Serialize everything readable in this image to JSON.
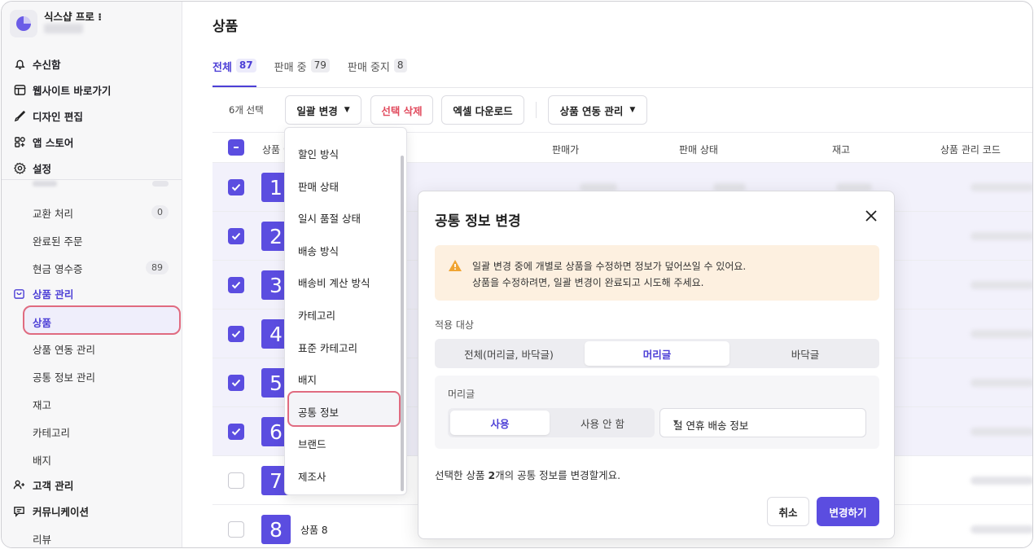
{
  "sidebar": {
    "store_name": "식스샵 프로 ⁝",
    "nav_top": [
      {
        "label": "수신함",
        "icon": "bell-icon"
      },
      {
        "label": "웹사이트 바로가기",
        "icon": "website-icon"
      },
      {
        "label": "디자인 편집",
        "icon": "brush-icon"
      },
      {
        "label": "앱 스토어",
        "icon": "apps-icon"
      },
      {
        "label": "설정",
        "icon": "gear-icon"
      }
    ],
    "order_items": [
      {
        "label": "교환 처리",
        "badge": "0"
      },
      {
        "label": "완료된 주문",
        "badge": ""
      },
      {
        "label": "현금 영수증",
        "badge": "89"
      }
    ],
    "product_group": "상품 관리",
    "product_items": [
      "상품",
      "상품 연동 관리",
      "공통 정보 관리",
      "재고",
      "카테고리",
      "배지"
    ],
    "customer_group": "고객 관리",
    "community_group": "커뮤니케이션",
    "review": "리뷰"
  },
  "main": {
    "title": "상품",
    "tabs": [
      {
        "label": "전체",
        "count": "87"
      },
      {
        "label": "판매 중",
        "count": "79"
      },
      {
        "label": "판매 중지",
        "count": "8"
      }
    ],
    "toolbar": {
      "selected": "6개 선택",
      "bulk_edit": "일괄 변경",
      "delete": "선택 삭제",
      "excel": "엑셀 다운로드",
      "link_manage": "상품 연동 관리"
    },
    "columns": [
      "상품 이",
      "판매가",
      "판매 상태",
      "재고",
      "상품 관리 코드"
    ],
    "rows": [
      {
        "num": "1",
        "name": "",
        "checked": true
      },
      {
        "num": "2",
        "name": "",
        "checked": true
      },
      {
        "num": "3",
        "name": "",
        "checked": true
      },
      {
        "num": "4",
        "name": "",
        "checked": true
      },
      {
        "num": "5",
        "name": "",
        "checked": true
      },
      {
        "num": "6",
        "name": "",
        "checked": true
      },
      {
        "num": "7",
        "name": "",
        "checked": false
      },
      {
        "num": "8",
        "name": "상품 8",
        "checked": false
      }
    ]
  },
  "dropdown": [
    "할인 방식",
    "판매 상태",
    "일시 품절 상태",
    "배송 방식",
    "배송비 계산 방식",
    "카테고리",
    "표준 카테고리",
    "배지",
    "공통 정보",
    "브랜드",
    "제조사"
  ],
  "modal": {
    "title": "공통 정보 변경",
    "warning_line1": "일괄 변경 중에 개별로 상품을 수정하면 정보가 덮어쓰일 수 있어요.",
    "warning_line2": "상품을 수정하려면, 일괄 변경이 완료되고 시도해 주세요.",
    "target_label": "적용 대상",
    "target_options": [
      "전체(머리글, 바닥글)",
      "머리글",
      "바닥글"
    ],
    "target_selected": "머리글",
    "header_label": "머리글",
    "use_options": [
      "사용",
      "사용 안 함"
    ],
    "use_selected": "사용",
    "select_value": "설 연휴 배송 정보",
    "summary_pre": "선택한 상품 ",
    "summary_bold": "2",
    "summary_post": "개의 공통 정보를 변경할게요.",
    "cancel": "취소",
    "confirm": "변경하기"
  },
  "colors": {
    "accent": "#5b4de0",
    "danger": "#e14a5d",
    "highlight": "#e06b80",
    "warning_bg": "#fdf0e0"
  }
}
